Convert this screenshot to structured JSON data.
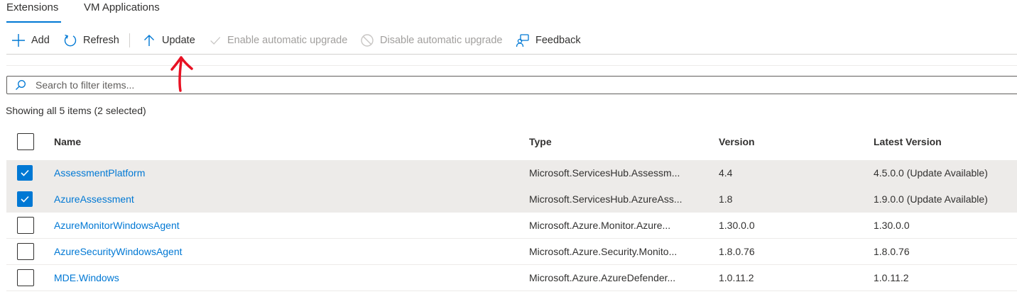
{
  "tabs": [
    {
      "label": "Extensions",
      "active": true
    },
    {
      "label": "VM Applications",
      "active": false
    }
  ],
  "toolbar": {
    "add": {
      "label": "Add",
      "icon": "plus-icon"
    },
    "refresh": {
      "label": "Refresh",
      "icon": "refresh-icon"
    },
    "update": {
      "label": "Update",
      "icon": "arrow-up-icon"
    },
    "enable_auto": {
      "label": "Enable automatic upgrade",
      "icon": "checkmark-icon",
      "disabled": true
    },
    "disable_auto": {
      "label": "Disable automatic upgrade",
      "icon": "prohibited-icon",
      "disabled": true
    },
    "feedback": {
      "label": "Feedback",
      "icon": "feedback-person-icon"
    }
  },
  "search": {
    "placeholder": "Search to filter items...",
    "value": ""
  },
  "summary": "Showing all 5 items (2 selected)",
  "grid": {
    "columns": [
      "Name",
      "Type",
      "Version",
      "Latest Version"
    ],
    "rows": [
      {
        "name": "AssessmentPlatform",
        "type": "Microsoft.ServicesHub.Assessm...",
        "version": "4.4",
        "latest": "4.5.0.0 (Update Available)",
        "selected": true
      },
      {
        "name": "AzureAssessment",
        "type": "Microsoft.ServicesHub.AzureAss...",
        "version": "1.8",
        "latest": "1.9.0.0 (Update Available)",
        "selected": true
      },
      {
        "name": "AzureMonitorWindowsAgent",
        "type": "Microsoft.Azure.Monitor.Azure...",
        "version": "1.30.0.0",
        "latest": "1.30.0.0",
        "selected": false
      },
      {
        "name": "AzureSecurityWindowsAgent",
        "type": "Microsoft.Azure.Security.Monito...",
        "version": "1.8.0.76",
        "latest": "1.8.0.76",
        "selected": false
      },
      {
        "name": "MDE.Windows",
        "type": "Microsoft.Azure.AzureDefender...",
        "version": "1.0.11.2",
        "latest": "1.0.11.2",
        "selected": false
      }
    ]
  },
  "colors": {
    "accent": "#0078d4",
    "selected_row": "#edebe9",
    "annotation": "#e81123",
    "disabled_text": "#a19f9d"
  }
}
